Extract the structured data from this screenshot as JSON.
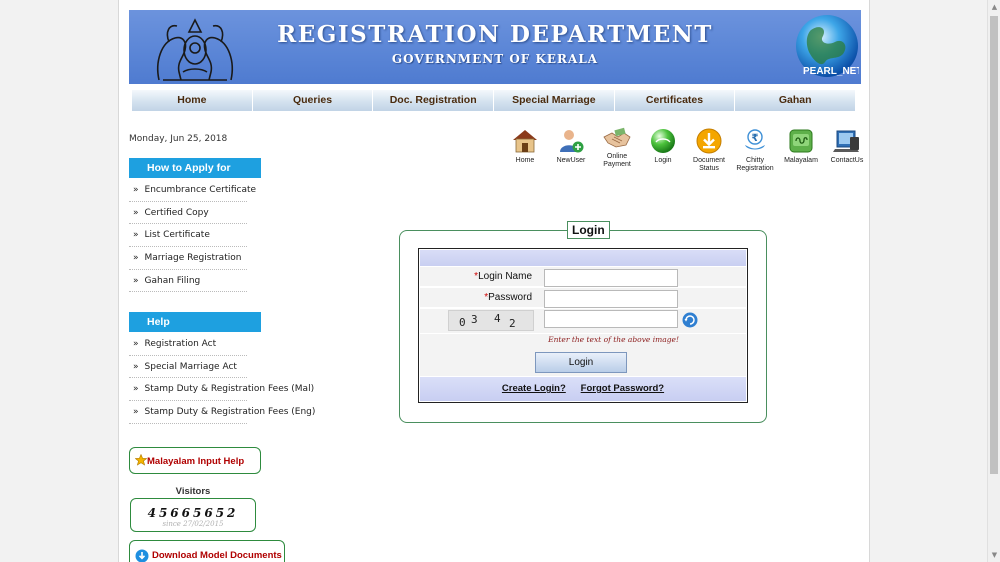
{
  "banner": {
    "title": "REGISTRATION DEPARTMENT",
    "subtitle": "GOVERNMENT OF KERALA",
    "logo_text": "PEARL_NET"
  },
  "nav": {
    "items": [
      {
        "label": "Home"
      },
      {
        "label": "Queries"
      },
      {
        "label": "Doc. Registration"
      },
      {
        "label": "Special Marriage"
      },
      {
        "label": "Certificates"
      },
      {
        "label": "Gahan"
      }
    ]
  },
  "date": "Monday, Jun 25, 2018",
  "how_to_apply": {
    "heading": "How to Apply for",
    "items": [
      {
        "label": "Encumbrance Certificate"
      },
      {
        "label": "Certified Copy"
      },
      {
        "label": "List Certificate"
      },
      {
        "label": "Marriage Registration"
      },
      {
        "label": "Gahan Filing"
      }
    ]
  },
  "help": {
    "heading": "Help",
    "items": [
      {
        "label": "Registration Act"
      },
      {
        "label": "Special Marriage Act"
      },
      {
        "label": "Stamp Duty & Registration Fees (Mal)"
      },
      {
        "label": "Stamp Duty & Registration Fees (Eng)"
      }
    ]
  },
  "bullet": "»",
  "malayalam_help": "Malayalam Input Help",
  "visitors": {
    "label": "Visitors",
    "count": "45665652",
    "since": "since 27/02/2015"
  },
  "download": "Download Model Documents",
  "quick_icons": [
    {
      "label": "Home",
      "icon": "house-icon"
    },
    {
      "label": "NewUser",
      "icon": "new-user-icon"
    },
    {
      "label": "Online\nPayment",
      "icon": "handshake-icon"
    },
    {
      "label": "Login",
      "icon": "login-orb-icon"
    },
    {
      "label": "Document\nStatus",
      "icon": "download-status-icon"
    },
    {
      "label": "Chitty\nRegistration",
      "icon": "rupee-hands-icon"
    },
    {
      "label": "Malayalam",
      "icon": "malayalam-icon"
    },
    {
      "label": "ContactUs",
      "icon": "contact-icon"
    }
  ],
  "login": {
    "legend": "Login",
    "required_marker": "*",
    "login_name_label": "Login Name",
    "password_label": "Password",
    "login_name_value": "",
    "password_value": "",
    "captcha_chars": [
      "0",
      "3",
      "4",
      "2"
    ],
    "captcha_value": "",
    "hint": "Enter the text of the above image!",
    "button": "Login",
    "create_login": "Create Login?",
    "forgot_password": "Forgot Password?"
  },
  "colors": {
    "banner": "#5a85d6",
    "section_head": "#1ea0e0",
    "frame_border": "#4a8f5e",
    "link_red": "#b00000"
  }
}
